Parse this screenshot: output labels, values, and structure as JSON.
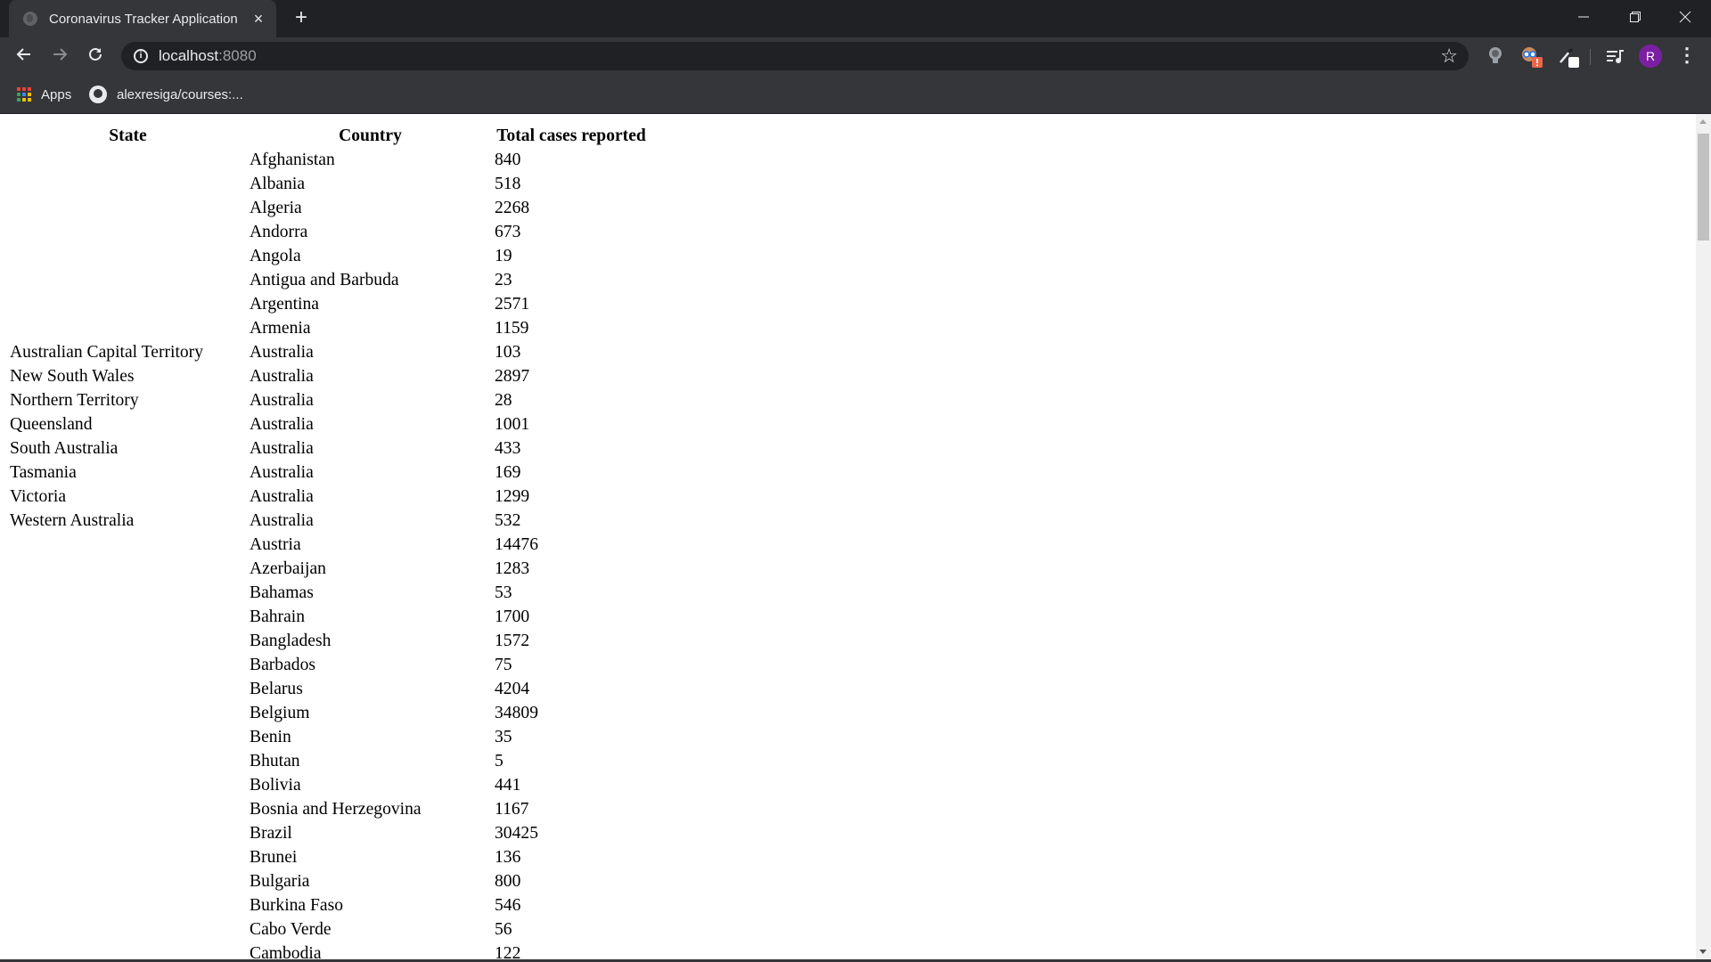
{
  "browser": {
    "tab": {
      "title": "Coronavirus Tracker Application",
      "favicon": "globe-icon",
      "close": "×"
    },
    "new_tab": "+",
    "window_controls": {
      "minimize": "—",
      "restore": "❐",
      "close": "✕"
    },
    "nav": {
      "back": "←",
      "forward": "→",
      "reload": "↻"
    },
    "url": {
      "host": "localhost",
      "port": ":8080"
    },
    "star": "☆",
    "avatar_initial": "R",
    "menu": "⋮",
    "bookmarks": [
      {
        "label": "Apps",
        "icon": "apps-grid-icon"
      },
      {
        "label": "alexresiga/courses:...",
        "icon": "github-icon"
      }
    ]
  },
  "table": {
    "headers": {
      "state": "State",
      "country": "Country",
      "total": "Total cases reported"
    },
    "rows": [
      {
        "state": "",
        "country": "Afghanistan",
        "total": "840"
      },
      {
        "state": "",
        "country": "Albania",
        "total": "518"
      },
      {
        "state": "",
        "country": "Algeria",
        "total": "2268"
      },
      {
        "state": "",
        "country": "Andorra",
        "total": "673"
      },
      {
        "state": "",
        "country": "Angola",
        "total": "19"
      },
      {
        "state": "",
        "country": "Antigua and Barbuda",
        "total": "23"
      },
      {
        "state": "",
        "country": "Argentina",
        "total": "2571"
      },
      {
        "state": "",
        "country": "Armenia",
        "total": "1159"
      },
      {
        "state": "Australian Capital Territory",
        "country": "Australia",
        "total": "103"
      },
      {
        "state": "New South Wales",
        "country": "Australia",
        "total": "2897"
      },
      {
        "state": "Northern Territory",
        "country": "Australia",
        "total": "28"
      },
      {
        "state": "Queensland",
        "country": "Australia",
        "total": "1001"
      },
      {
        "state": "South Australia",
        "country": "Australia",
        "total": "433"
      },
      {
        "state": "Tasmania",
        "country": "Australia",
        "total": "169"
      },
      {
        "state": "Victoria",
        "country": "Australia",
        "total": "1299"
      },
      {
        "state": "Western Australia",
        "country": "Australia",
        "total": "532"
      },
      {
        "state": "",
        "country": "Austria",
        "total": "14476"
      },
      {
        "state": "",
        "country": "Azerbaijan",
        "total": "1283"
      },
      {
        "state": "",
        "country": "Bahamas",
        "total": "53"
      },
      {
        "state": "",
        "country": "Bahrain",
        "total": "1700"
      },
      {
        "state": "",
        "country": "Bangladesh",
        "total": "1572"
      },
      {
        "state": "",
        "country": "Barbados",
        "total": "75"
      },
      {
        "state": "",
        "country": "Belarus",
        "total": "4204"
      },
      {
        "state": "",
        "country": "Belgium",
        "total": "34809"
      },
      {
        "state": "",
        "country": "Benin",
        "total": "35"
      },
      {
        "state": "",
        "country": "Bhutan",
        "total": "5"
      },
      {
        "state": "",
        "country": "Bolivia",
        "total": "441"
      },
      {
        "state": "",
        "country": "Bosnia and Herzegovina",
        "total": "1167"
      },
      {
        "state": "",
        "country": "Brazil",
        "total": "30425"
      },
      {
        "state": "",
        "country": "Brunei",
        "total": "136"
      },
      {
        "state": "",
        "country": "Bulgaria",
        "total": "800"
      },
      {
        "state": "",
        "country": "Burkina Faso",
        "total": "546"
      },
      {
        "state": "",
        "country": "Cabo Verde",
        "total": "56"
      },
      {
        "state": "",
        "country": "Cambodia",
        "total": "122"
      }
    ]
  }
}
